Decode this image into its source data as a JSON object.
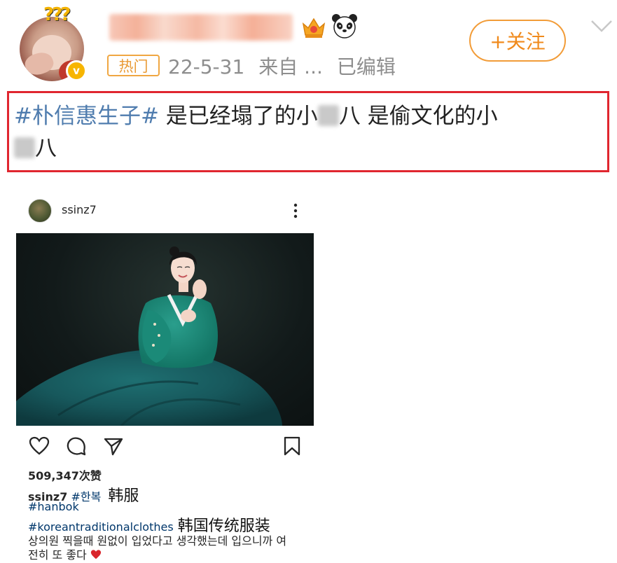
{
  "header": {
    "hot_tag": "热门",
    "date": "22-5-31",
    "source": "来自 ...",
    "edited": "已编辑",
    "follow_label": "+关注",
    "verified_mark": "v"
  },
  "post": {
    "hashtag": "#朴信惠生子#",
    "text_a": " 是已经塌了的小",
    "text_b": "八  是偷文化的小",
    "text_c": "八"
  },
  "instagram": {
    "username": "ssinz7",
    "likes": "509,347次赞",
    "caption_user": "ssinz7",
    "caption_tag": "#한복",
    "caption_annotation": "韩服",
    "tag_hanbok": "#hanbok",
    "tag_korean": "#koreantraditionalclothes",
    "tag_annotation": "韩国传统服装",
    "caption_line1": "상의원 찍을때 원없이 입었다고 생각했는데 입으니까 여",
    "caption_line2": "전히 또 좋다"
  },
  "icons": {
    "crown": "crown-icon",
    "panda": "panda-icon",
    "chevron": "chevron-down-icon",
    "more": "more-vertical-icon",
    "like": "heart-icon",
    "comment": "comment-icon",
    "share": "send-icon",
    "save": "bookmark-icon",
    "heart_emoji": "heart-emoji-icon"
  },
  "colors": {
    "accent_orange": "#f08a1c",
    "hashtag_blue": "#4f7cae",
    "highlight_red": "#e0262f",
    "ig_tag_blue": "#00376b"
  }
}
